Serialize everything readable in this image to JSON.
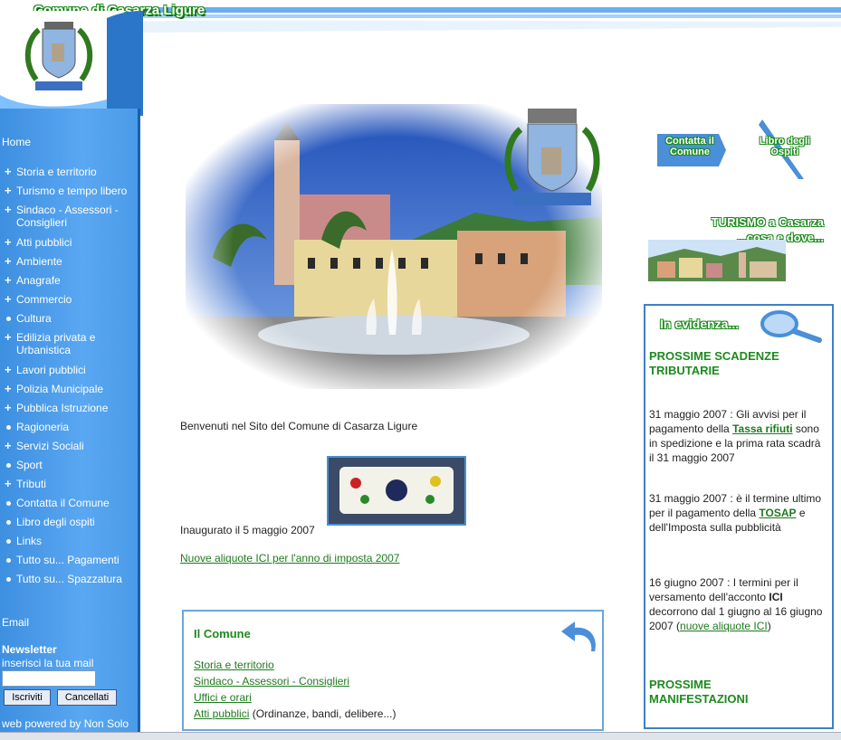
{
  "header": {
    "site_title": "Comune di Casarza Ligure"
  },
  "sidebar": {
    "home": "Home",
    "items": [
      {
        "label": "Storia e territorio",
        "marker": "plus"
      },
      {
        "label": "Turismo e tempo libero",
        "marker": "plus"
      },
      {
        "label": "Sindaco - Assessori - Consiglieri",
        "marker": "plus"
      },
      {
        "label": "Atti pubblici",
        "marker": "plus"
      },
      {
        "label": "Ambiente",
        "marker": "plus"
      },
      {
        "label": "Anagrafe",
        "marker": "plus"
      },
      {
        "label": "Commercio",
        "marker": "plus"
      },
      {
        "label": "Cultura",
        "marker": "dot"
      },
      {
        "label": "Edilizia privata e Urbanistica",
        "marker": "plus"
      },
      {
        "label": "Lavori pubblici",
        "marker": "plus"
      },
      {
        "label": "Polizia Municipale",
        "marker": "plus"
      },
      {
        "label": "Pubblica Istruzione",
        "marker": "plus"
      },
      {
        "label": "Ragioneria",
        "marker": "dot"
      },
      {
        "label": "Servizi Sociali",
        "marker": "plus"
      },
      {
        "label": "Sport",
        "marker": "dot"
      },
      {
        "label": "Tributi",
        "marker": "plus"
      },
      {
        "label": "Contatta il Comune",
        "marker": "dot"
      },
      {
        "label": "Libro degli ospiti",
        "marker": "dot"
      },
      {
        "label": "Links",
        "marker": "dot"
      },
      {
        "label": "Tutto su... Pagamenti",
        "marker": "dot"
      },
      {
        "label": "Tutto su... Spazzatura",
        "marker": "dot"
      }
    ],
    "email": "Email",
    "newsletter_title": "Newsletter",
    "newsletter_sub": "inserisci la tua mail",
    "newsletter_value": "",
    "subscribe_label": "Iscriviti",
    "cancel_label": "Cancellati",
    "powered": "web powered by Non Solo"
  },
  "main": {
    "welcome": "Benvenuti nel Sito del Comune di Casarza Ligure",
    "inaugurated": "Inaugurato il 5 maggio 2007",
    "ici_link": "Nuove aliquote ICI per l'anno di imposta 2007",
    "comune_box": {
      "title": "Il Comune",
      "links": [
        {
          "label": "Storia e territorio",
          "note": ""
        },
        {
          "label": "Sindaco - Assessori - Consiglieri",
          "note": ""
        },
        {
          "label": "Uffici e orari",
          "note": ""
        },
        {
          "label": "Atti pubblici",
          "note": " (Ordinanze, bandi, delibere...)"
        }
      ]
    }
  },
  "right": {
    "contatta": "Contatta il Comune",
    "contatta_l1": "Contatta il",
    "contatta_l2": "Comune",
    "libro_l1": "Libro degli",
    "libro_l2": "Ospiti",
    "turismo_l1": "TURISMO a Casarza",
    "turismo_l2": "...cosa e dove...",
    "evidenza": "In evidenza...",
    "scadenze_title_l1": "PROSSIME SCADENZE",
    "scadenze_title_l2": "TRIBUTARIE",
    "item1_pre": "31 maggio 2007 : Gli avvisi per il pagamento della ",
    "item1_link": "Tassa rifiuti",
    "item1_post": " sono in spedizione e la prima rata scadrà il 31 maggio 2007",
    "item2_pre": "31 maggio 2007 : è il termine ultimo per il pagamento della ",
    "item2_link": "TOSAP",
    "item2_post": " e dell'Imposta sulla pubblicità",
    "item3_pre": "16 giugno 2007 : I termini per il versamento dell'acconto ",
    "item3_bold": "ICI",
    "item3_mid": " decorrono dal 1 giugno al 16 giugno 2007 (",
    "item3_link": "nuove aliquote ICI",
    "item3_post": ")",
    "manifest_l1": "PROSSIME",
    "manifest_l2": "MANIFESTAZIONI"
  },
  "colors": {
    "sidebar_blue": "#4a9be8",
    "link_green": "#1e7a1e",
    "title_green": "#1e8a1e",
    "box_border": "#3f80c4"
  }
}
